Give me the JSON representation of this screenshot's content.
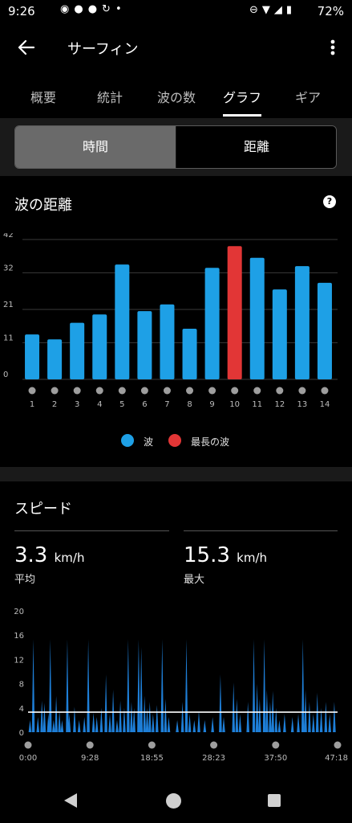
{
  "status": {
    "time": "9:26",
    "battery": "72%"
  },
  "header": {
    "title": "サーフィン",
    "back_icon": "arrow-left-icon",
    "more_icon": "more-vert-icon"
  },
  "tabs": [
    {
      "label": "概要"
    },
    {
      "label": "統計"
    },
    {
      "label": "波の数"
    },
    {
      "label": "グラフ",
      "active": true
    },
    {
      "label": "ギア"
    }
  ],
  "toggle": {
    "left": "時間",
    "right": "距離",
    "selected": "left"
  },
  "wave_card": {
    "title": "波の距離",
    "help_icon": "question-icon",
    "legend": [
      {
        "label": "波",
        "color": "#1ea0e6"
      },
      {
        "label": "最長の波",
        "color": "#e23636"
      }
    ]
  },
  "speed_card": {
    "title": "スピード",
    "avg_value": "3.3",
    "avg_unit": "km/h",
    "avg_label": "平均",
    "max_value": "15.3",
    "max_unit": "km/h",
    "max_label": "最大"
  },
  "chart_data": [
    {
      "type": "bar",
      "title": "波の距離",
      "categories": [
        "1",
        "2",
        "3",
        "4",
        "5",
        "6",
        "7",
        "8",
        "9",
        "10",
        "11",
        "12",
        "13",
        "14"
      ],
      "y_ticks": [
        "0",
        "11",
        "21",
        "32",
        "42"
      ],
      "ylim": [
        0,
        42
      ],
      "series": [
        {
          "name": "波",
          "values": [
            13.5,
            12,
            17,
            19.5,
            34.5,
            20.5,
            22.5,
            15.2,
            33.5,
            0,
            36.5,
            27,
            34,
            29
          ]
        },
        {
          "name": "最長の波",
          "values": [
            0,
            0,
            0,
            0,
            0,
            0,
            0,
            0,
            0,
            40,
            0,
            0,
            0,
            0
          ]
        }
      ],
      "grid": true
    },
    {
      "type": "area",
      "title": "スピード",
      "x_ticks": [
        "0:00",
        "9:28",
        "18:55",
        "28:23",
        "37:50",
        "47:18"
      ],
      "y_ticks": [
        "0",
        "4",
        "8",
        "12",
        "16",
        "20"
      ],
      "ylim": [
        0,
        20
      ],
      "average": 3.3,
      "spikes": [
        [
          0.3,
          2
        ],
        [
          0.8,
          15.3
        ],
        [
          1.5,
          2.5
        ],
        [
          2.1,
          5.2
        ],
        [
          2.5,
          4.8
        ],
        [
          3.1,
          3
        ],
        [
          3.4,
          15.3
        ],
        [
          3.9,
          2
        ],
        [
          4.3,
          6
        ],
        [
          4.8,
          3.5
        ],
        [
          5.2,
          2
        ],
        [
          6.0,
          15.3
        ],
        [
          6.3,
          3
        ],
        [
          7.1,
          4.2
        ],
        [
          7.8,
          2
        ],
        [
          8.6,
          2.5
        ],
        [
          9.2,
          15.3
        ],
        [
          10.0,
          3.2
        ],
        [
          10.5,
          2.5
        ],
        [
          11.2,
          4
        ],
        [
          11.9,
          9.5
        ],
        [
          12.5,
          3
        ],
        [
          13.0,
          7
        ],
        [
          13.6,
          2
        ],
        [
          14.1,
          5.2
        ],
        [
          14.7,
          4
        ],
        [
          15.3,
          15.3
        ],
        [
          15.8,
          5
        ],
        [
          16.2,
          4
        ],
        [
          16.9,
          15.3
        ],
        [
          17.3,
          14
        ],
        [
          17.8,
          6
        ],
        [
          18.2,
          4
        ],
        [
          18.6,
          5
        ],
        [
          19.1,
          3
        ],
        [
          19.7,
          4.5
        ],
        [
          20.5,
          15.3
        ],
        [
          21.0,
          5.5
        ],
        [
          21.5,
          2.5
        ],
        [
          22.8,
          2
        ],
        [
          23.6,
          5
        ],
        [
          24.2,
          15.3
        ],
        [
          24.7,
          3
        ],
        [
          25.4,
          2
        ],
        [
          26.1,
          3.5
        ],
        [
          27.0,
          2
        ],
        [
          28.2,
          2.5
        ],
        [
          29.4,
          9.5
        ],
        [
          29.9,
          2.5
        ],
        [
          31.4,
          8.2
        ],
        [
          31.9,
          5.5
        ],
        [
          32.4,
          3
        ],
        [
          33.6,
          5
        ],
        [
          34.5,
          15.3
        ],
        [
          35.0,
          8
        ],
        [
          35.4,
          5.5
        ],
        [
          36.1,
          15.3
        ],
        [
          36.5,
          7
        ],
        [
          37.0,
          5
        ],
        [
          37.4,
          6.8
        ],
        [
          37.9,
          4
        ],
        [
          38.4,
          2
        ],
        [
          39.2,
          3
        ],
        [
          40.4,
          2.5
        ],
        [
          41.3,
          3
        ],
        [
          42.0,
          15.3
        ],
        [
          42.4,
          7
        ],
        [
          43.0,
          5
        ],
        [
          43.6,
          3
        ],
        [
          44.2,
          6.5
        ],
        [
          44.8,
          4
        ],
        [
          45.5,
          5
        ],
        [
          46.1,
          3
        ],
        [
          46.8,
          5
        ]
      ]
    }
  ]
}
